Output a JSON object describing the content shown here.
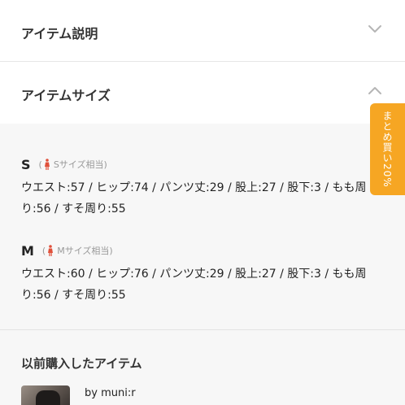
{
  "accordion": {
    "item_description": {
      "label": "アイテム説明",
      "icon": "chevron-down-icon",
      "expanded": false
    },
    "item_size": {
      "label": "アイテムサイズ",
      "icon": "chevron-up-icon",
      "expanded": true
    }
  },
  "sizes": [
    {
      "size": "S",
      "note_open": "(",
      "note": "Sサイズ相当",
      "note_close": ")",
      "measurements": "ウエスト:57 / ヒップ:74 / パンツ丈:29 / 股上:27 / 股下:3 / もも周り:56 / すそ周り:55"
    },
    {
      "size": "M",
      "note_open": "(",
      "note": "Mサイズ相当",
      "note_close": ")",
      "measurements": "ウエスト:60 / ヒップ:76 / パンツ丈:29 / 股上:27 / 股下:3 / もも周り:56 / すそ周り:55"
    }
  ],
  "promo_tab": {
    "label": "まとめ買い20%"
  },
  "previous_items": {
    "title": "以前購入したアイテム",
    "by_label": "by muni:r"
  },
  "colors": {
    "accent": "#f6a623",
    "person_icon": "#e0503a",
    "chevron": "#b5b5b5"
  }
}
